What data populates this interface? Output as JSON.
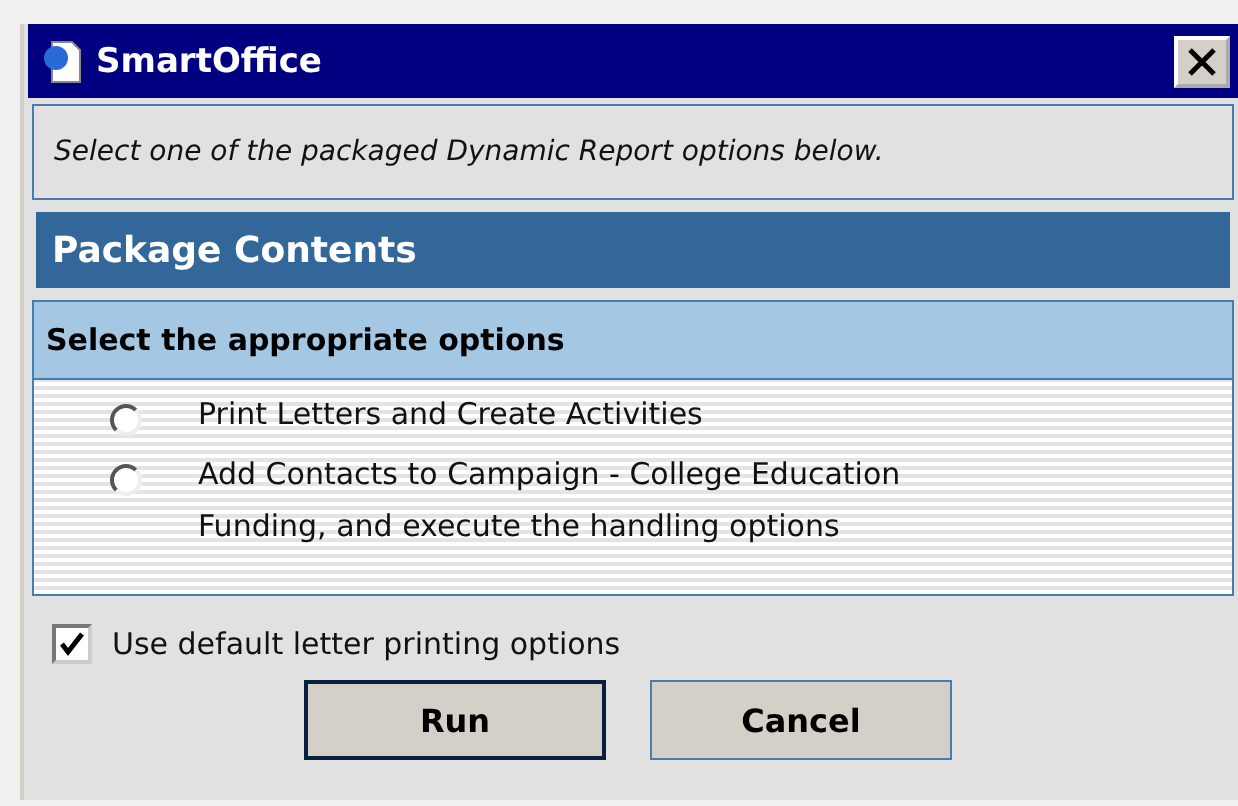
{
  "window": {
    "title": "SmartOffice"
  },
  "instruction": "Select one of the packaged Dynamic Report options below.",
  "section_title": "Package Contents",
  "options_panel": {
    "heading": "Select the appropriate options",
    "options": [
      {
        "label": "Print Letters and Create Activities",
        "selected": false
      },
      {
        "label": "Add Contacts to Campaign - College Education Funding, and execute the handling options",
        "selected": false
      }
    ]
  },
  "default_printing": {
    "label": "Use default letter printing options",
    "checked": true
  },
  "buttons": [
    {
      "label": "Run",
      "default": true
    },
    {
      "label": "Cancel",
      "default": false
    }
  ]
}
